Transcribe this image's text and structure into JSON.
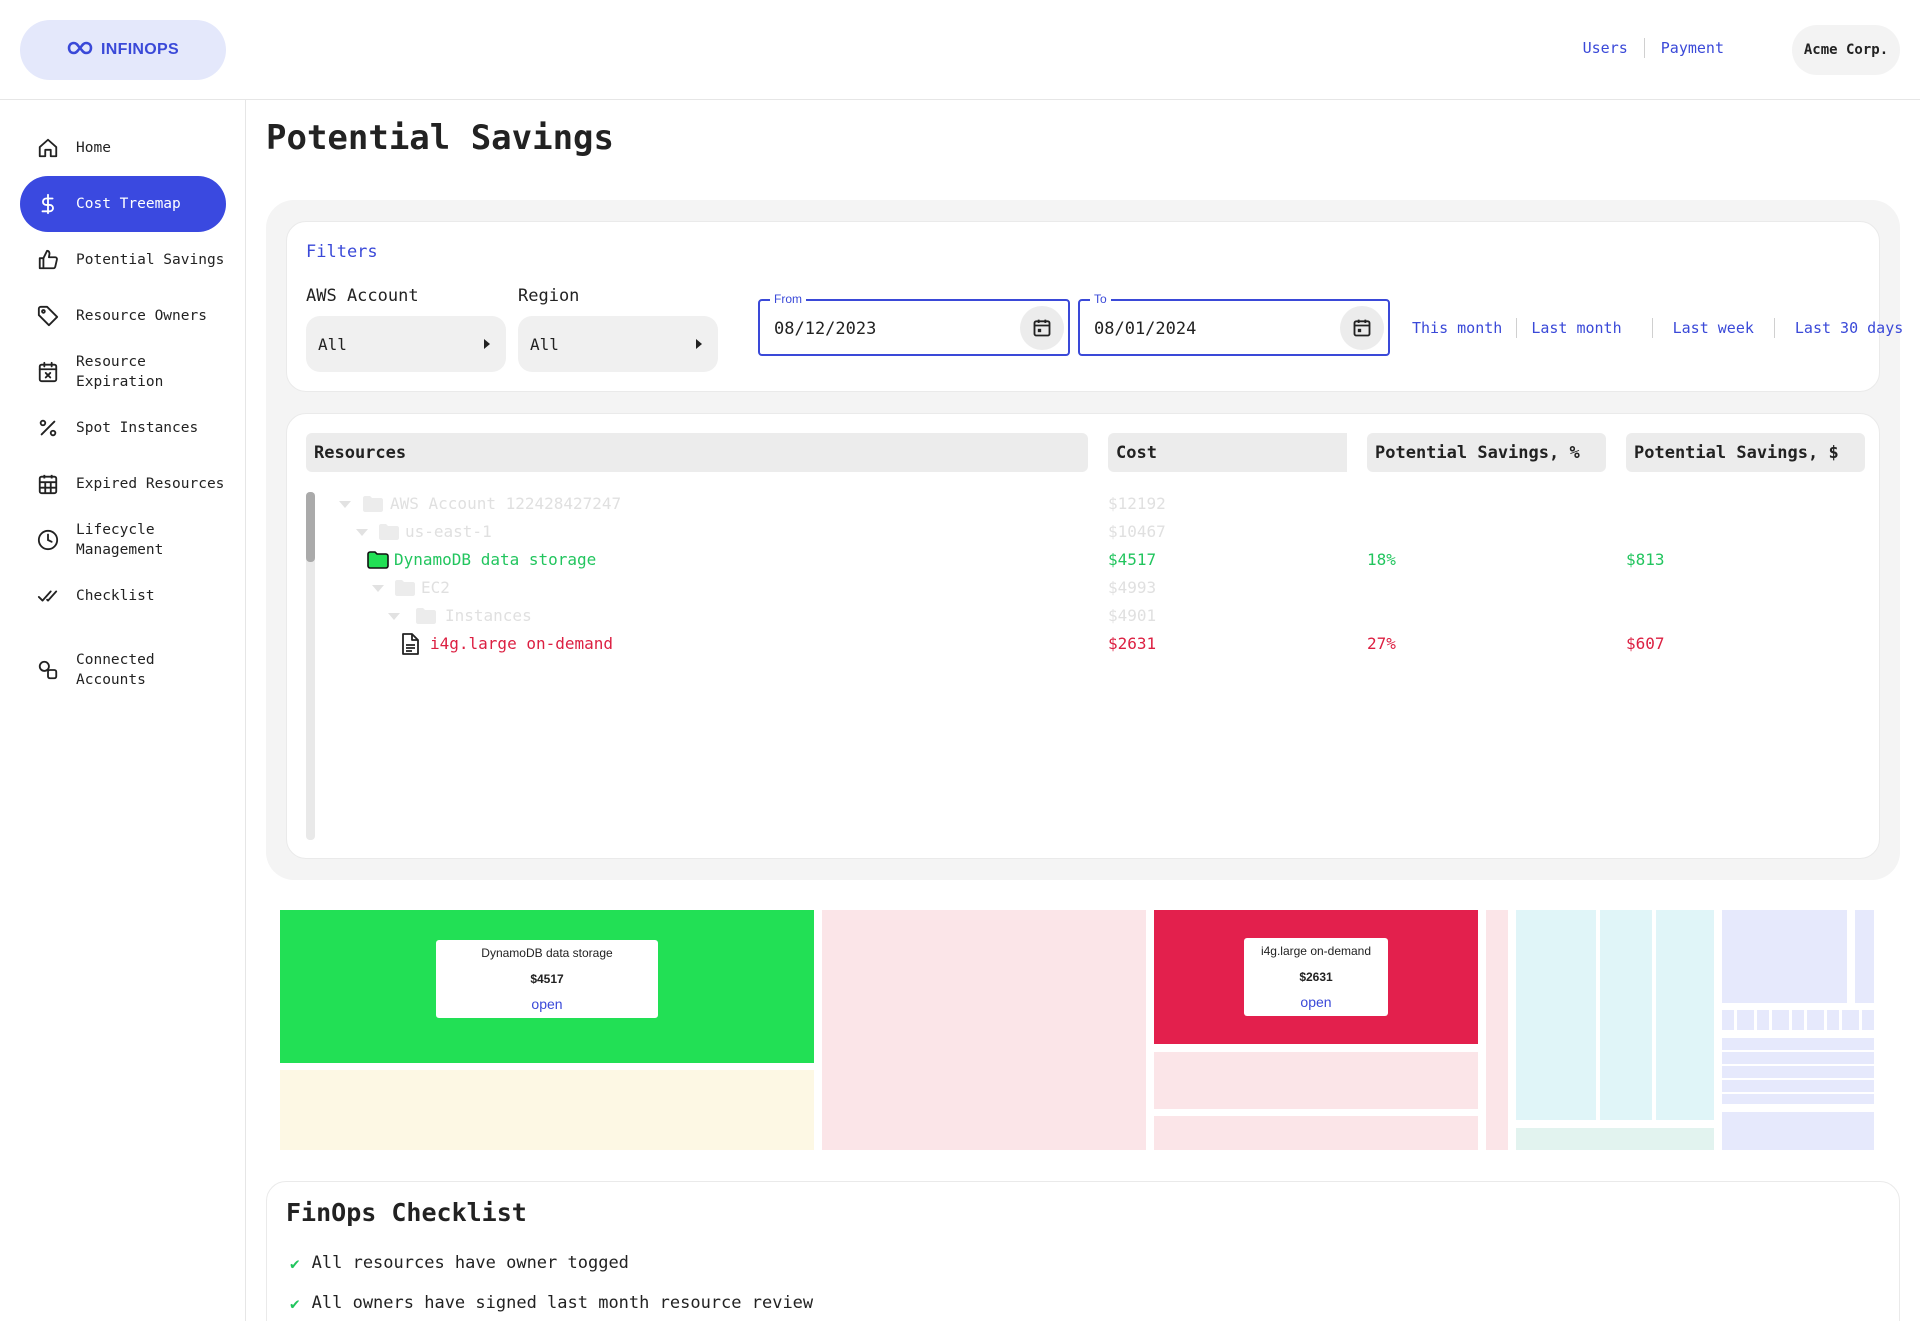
{
  "header": {
    "logo_text": "INFINOPS",
    "links": [
      "Users",
      "Payment"
    ],
    "company": "Acme Corp."
  },
  "sidebar": {
    "items": [
      {
        "label": "Home",
        "icon": "home-icon"
      },
      {
        "label": "Cost Treemap",
        "icon": "dollar-icon",
        "active": true
      },
      {
        "label": "Potential Savings",
        "icon": "thumbs-up-icon"
      },
      {
        "label": "Resource Owners",
        "icon": "tag-icon"
      },
      {
        "label": "Resource Expiration",
        "icon": "calendar-x-icon"
      },
      {
        "label": "Spot Instances",
        "icon": "percent-icon"
      },
      {
        "label": "Expired Resources",
        "icon": "grid-calendar-icon"
      },
      {
        "label": "Lifecycle Management",
        "icon": "clock-icon"
      },
      {
        "label": "Checklist",
        "icon": "double-check-icon"
      },
      {
        "label": "Connected Accounts",
        "icon": "link-shapes-icon"
      }
    ]
  },
  "page": {
    "title": "Potential Savings"
  },
  "filters": {
    "title": "Filters",
    "aws_account_label": "AWS Account",
    "aws_account_value": "All",
    "region_label": "Region",
    "region_value": "All",
    "from_label": "From",
    "from_value": "08/12/2023",
    "to_label": "To",
    "to_value": "08/01/2024",
    "quick_ranges": [
      "This month",
      "Last month",
      "Last week",
      "Last 30 days"
    ]
  },
  "table": {
    "headers": [
      "Resources",
      "Cost",
      "Potential Savings, %",
      "Potential Savings, $"
    ],
    "rows": [
      {
        "name": "AWS Account 122428427247",
        "cost": "$12192",
        "pct": "",
        "usd": ""
      },
      {
        "name": "us-east-1",
        "cost": "$10467",
        "pct": "",
        "usd": ""
      },
      {
        "name": "DynamoDB data storage",
        "cost": "$4517",
        "pct": "18%",
        "usd": "$813"
      },
      {
        "name": "EC2",
        "cost": "$4993",
        "pct": "",
        "usd": ""
      },
      {
        "name": "Instances",
        "cost": "$4901",
        "pct": "",
        "usd": ""
      },
      {
        "name": "i4g.large on-demand",
        "cost": "$2631",
        "pct": "27%",
        "usd": "$607"
      }
    ]
  },
  "treemap": {
    "tooltips": [
      {
        "name": "DynamoDB data storage",
        "value": "$4517",
        "action": "open"
      },
      {
        "name": "i4g.large on-demand",
        "value": "$2631",
        "action": "open"
      }
    ]
  },
  "checklist": {
    "title": "FinOps Checklist",
    "items": [
      "All resources have owner togged",
      "All owners have signed last month resource review"
    ]
  },
  "colors": {
    "accent": "#3a49e0",
    "savings_green": "#22c55e",
    "alert_red": "#dc2042"
  }
}
